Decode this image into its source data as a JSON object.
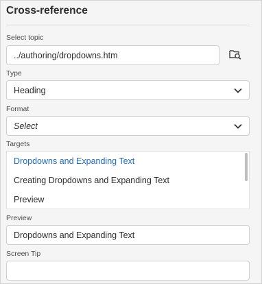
{
  "panel": {
    "title": "Cross-reference"
  },
  "select_topic": {
    "label": "Select topic",
    "value": "../authoring/dropdowns.htm",
    "browse_icon": "folder-search-icon"
  },
  "type": {
    "label": "Type",
    "value": "Heading"
  },
  "format": {
    "label": "Format",
    "value": "Select"
  },
  "targets": {
    "label": "Targets",
    "items": [
      {
        "label": "Dropdowns and Expanding Text"
      },
      {
        "label": "Creating Dropdowns and Expanding Text"
      },
      {
        "label": "Preview"
      }
    ]
  },
  "preview": {
    "label": "Preview",
    "value": "Dropdowns and Expanding Text"
  },
  "screen_tip": {
    "label": "Screen Tip",
    "value": ""
  },
  "colors": {
    "accent": "#1b6ac9",
    "background": "#f5f5f5",
    "border": "#cfcfcf"
  }
}
